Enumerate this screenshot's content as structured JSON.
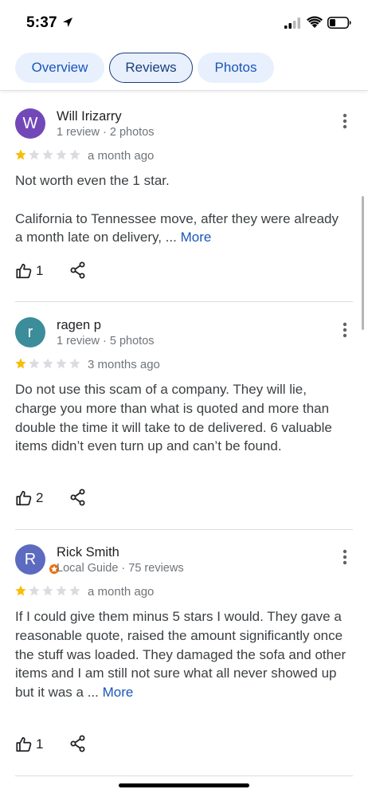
{
  "status_bar": {
    "time": "5:37"
  },
  "tabs": [
    {
      "label": "Overview"
    },
    {
      "label": "Reviews",
      "selected": true
    },
    {
      "label": "Photos"
    }
  ],
  "colors": {
    "star_filled": "#fbbc04",
    "star_empty": "#dadce0",
    "link": "#1a56b8"
  },
  "reviews": [
    {
      "avatar_letter": "W",
      "avatar_color": "#7248b9",
      "author": "Will Irizarry",
      "meta": "1 review · 2 photos",
      "rating": 1,
      "date": "a month ago",
      "paragraph1": "Not worth even the 1 star.",
      "paragraph2": "California to Tennessee move, after they were already a month late on delivery, ...",
      "more": "More",
      "likes": "1"
    },
    {
      "avatar_letter": "r",
      "avatar_color": "#3c8d9a",
      "author": "ragen p",
      "meta": "1 review · 5 photos",
      "rating": 1,
      "date": "3 months ago",
      "paragraph1": "Do not use this scam of a company. They will lie, charge you more than what is quoted and more than double the time it will take to de delivered. 6 valuable items didn’t even turn up and can’t be found.",
      "likes": "2"
    },
    {
      "avatar_letter": "R",
      "avatar_color": "#5c6bc0",
      "author": "Rick Smith",
      "meta": "Local Guide · 75 reviews",
      "rating": 1,
      "date": "a month ago",
      "paragraph1": "If I could give them minus 5 stars I would. They gave a reasonable quote, raised the amount significantly once the stuff was loaded.  They damaged the sofa and other items and I am still not sure what all never showed up but it was a ...",
      "more": "More",
      "likes": "1"
    }
  ]
}
